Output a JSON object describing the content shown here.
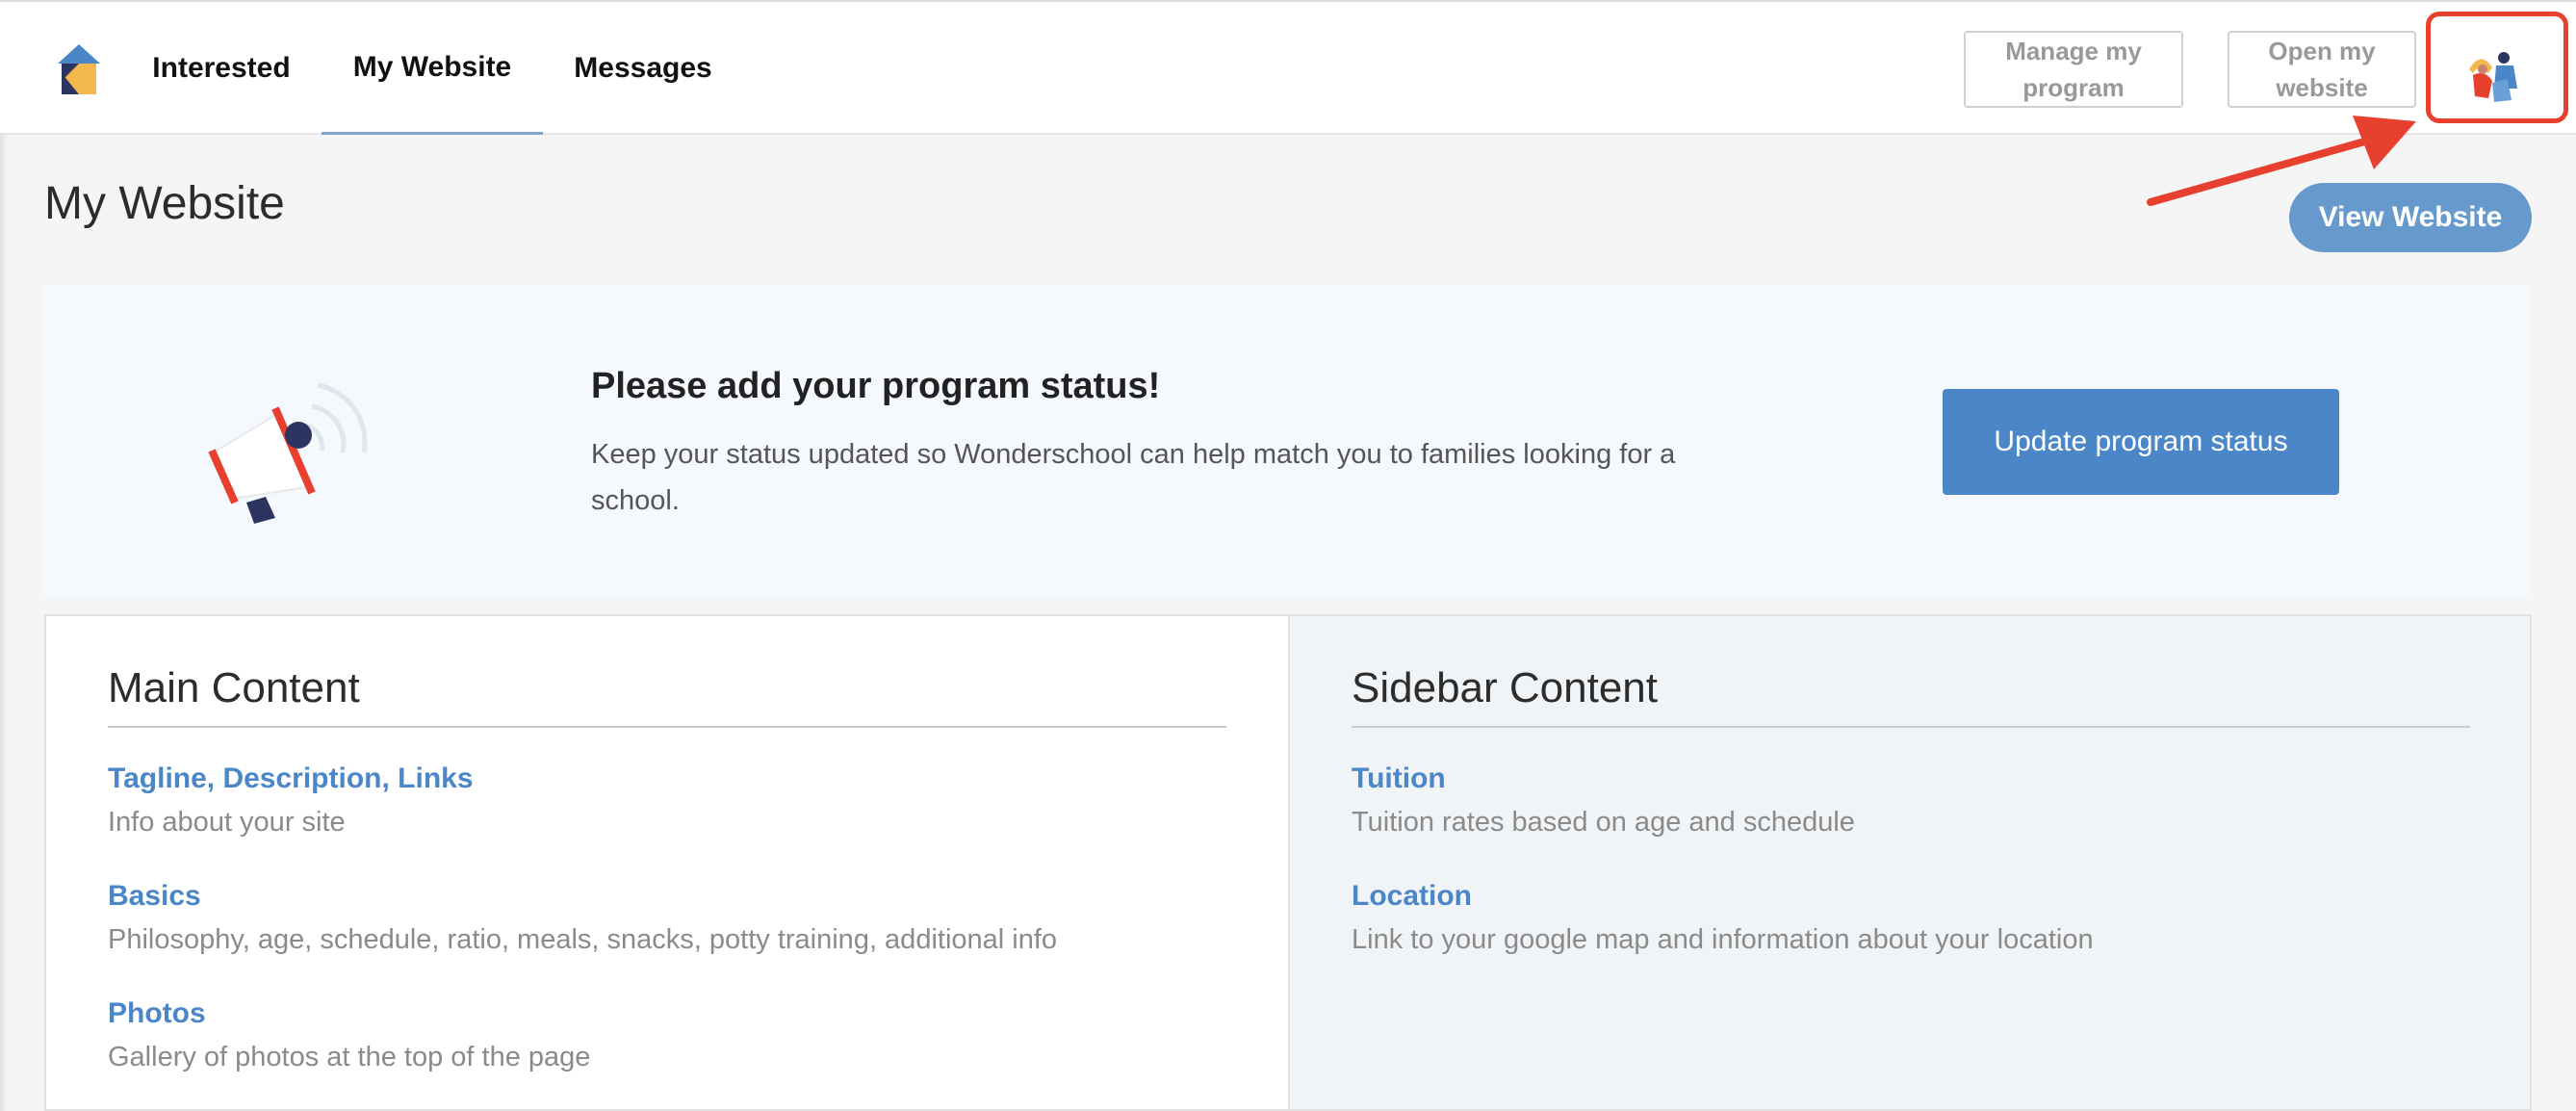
{
  "nav": {
    "tabs": [
      {
        "label": "Interested"
      },
      {
        "label": "My Website"
      },
      {
        "label": "Messages"
      }
    ],
    "manage_program": "Manage my\nprogram",
    "open_website": "Open my\nwebsite"
  },
  "page": {
    "title": "My Website",
    "view_website": "View Website"
  },
  "banner": {
    "title": "Please add your program status!",
    "text": "Keep your status updated so Wonderschool can help match you to families looking for a school.",
    "button": "Update program status"
  },
  "main_content": {
    "heading": "Main Content",
    "items": [
      {
        "label": "Tagline, Description, Links",
        "desc": "Info about your site"
      },
      {
        "label": "Basics",
        "desc": "Philosophy, age, schedule, ratio, meals, snacks, potty training, additional info"
      },
      {
        "label": "Photos",
        "desc": "Gallery of photos at the top of the page"
      }
    ]
  },
  "sidebar_content": {
    "heading": "Sidebar Content",
    "items": [
      {
        "label": "Tuition",
        "desc": "Tuition rates based on age and schedule"
      },
      {
        "label": "Location",
        "desc": "Link to your google map and information about your location"
      }
    ]
  },
  "colors": {
    "accent": "#4a86c8",
    "highlight": "#e8402f"
  },
  "icons": [
    "logo-icon",
    "avatar-image",
    "annotation-arrow",
    "megaphone-icon"
  ]
}
